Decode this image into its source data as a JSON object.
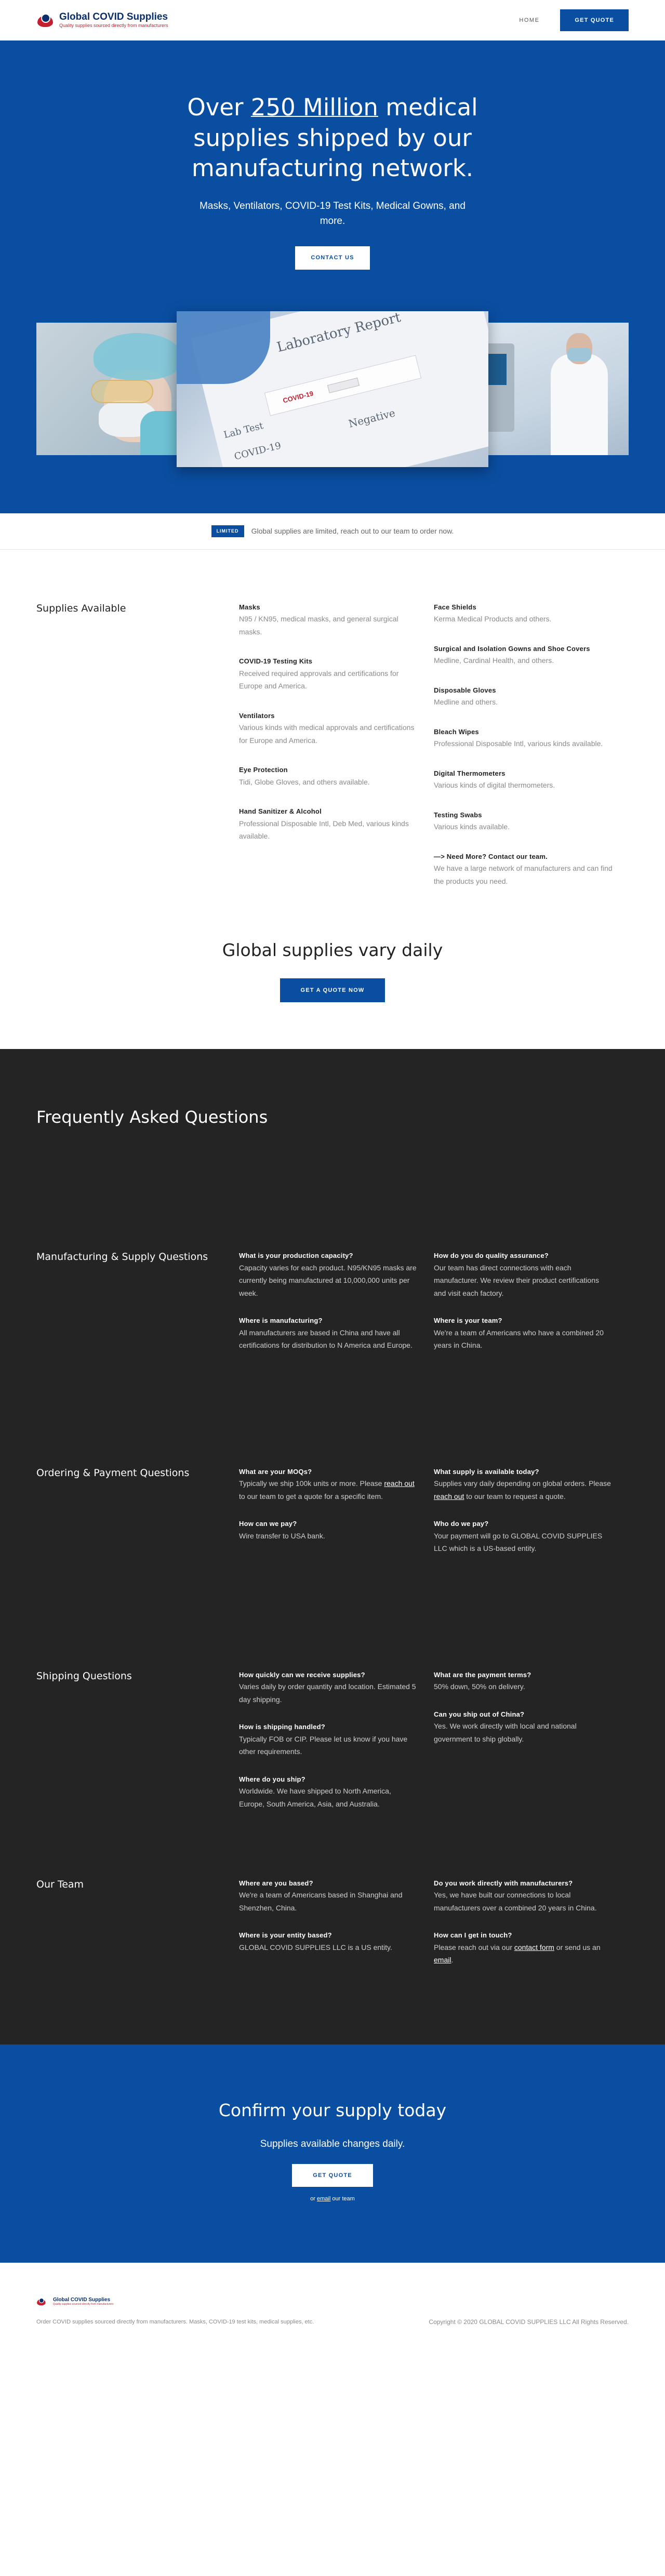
{
  "brand": {
    "name": "Global COVID Supplies",
    "tagline": "Quality supplies sourced directly from manufacturers"
  },
  "nav": {
    "home": "HOME",
    "cta": "GET QUOTE"
  },
  "hero": {
    "title_pre": "Over ",
    "title_highlight": "250 Million",
    "title_post": " medical supplies shipped by our manufacturing network.",
    "subtitle": "Masks, Ventilators, COVID-19 Test Kits, Medical Gowns, and more.",
    "cta": "CONTACT US",
    "test_card": {
      "label1": "Lab Test",
      "label2": "COVID-19",
      "label3": "Negative",
      "strip": "COVID-19",
      "heading": "Laboratory Report"
    }
  },
  "limited": {
    "badge": "LIMITED",
    "text": "Global supplies are limited, reach out to our team to order now."
  },
  "supplies": {
    "heading": "Supplies Available",
    "col_a": [
      {
        "title": "Masks",
        "desc": "N95 / KN95, medical masks, and general surgical masks."
      },
      {
        "title": "COVID-19 Testing Kits",
        "desc": "Received required approvals and certifications for Europe and America."
      },
      {
        "title": "Ventilators",
        "desc": "Various kinds with medical approvals and certifications for Europe and America."
      },
      {
        "title": "Eye Protection",
        "desc": "Tidi, Globe Gloves, and others available."
      },
      {
        "title": "Hand Sanitizer & Alcohol",
        "desc": "Professional Disposable Intl, Deb Med, various kinds available."
      }
    ],
    "col_b": [
      {
        "title": "Face Shields",
        "desc": "Kerma Medical Products and others."
      },
      {
        "title": "Surgical and Isolation Gowns and Shoe Covers",
        "desc": "Medline, Cardinal Health, and others."
      },
      {
        "title": "Disposable Gloves",
        "desc": "Medline and others."
      },
      {
        "title": "Bleach Wipes",
        "desc": "Professional Disposable Intl, various kinds available."
      },
      {
        "title": "Digital Thermometers",
        "desc": "Various kinds of digital thermometers."
      },
      {
        "title": "Testing Swabs",
        "desc": "Various kinds available."
      },
      {
        "title": "—> Need More? Contact our team.",
        "desc": "We have a large network of manufacturers and can find the products you need."
      }
    ],
    "vary_title": "Global supplies vary daily",
    "vary_cta": "GET A QUOTE NOW"
  },
  "faq": {
    "heading": "Frequently Asked Questions",
    "manufacturing": {
      "title": "Manufacturing & Supply Questions",
      "q1": {
        "q": "What is your production capacity?",
        "a": "Capacity varies for each product. N95/KN95 masks are currently being manufactured at 10,000,000 units per week."
      },
      "q2": {
        "q": "Where is manufacturing?",
        "a": "All manufacturers are based in China and have all certifications for distribution to N America and Europe."
      },
      "q3": {
        "q": "How do you do quality assurance?",
        "a": "Our team has direct connections with each manufacturer. We review their product certifications and visit each factory."
      },
      "q4": {
        "q": "Where is your team?",
        "a": "We're a team of Americans who have a combined 20 years in China."
      }
    },
    "ordering": {
      "title": "Ordering & Payment Questions",
      "q1": {
        "q": "What are your MOQs?",
        "a_pre": "Typically we ship 100k units or more. Please ",
        "a_link": "reach out",
        "a_post": " to our team to get a quote for a specific item."
      },
      "q2": {
        "q": "How can we pay?",
        "a": "Wire transfer to USA bank."
      },
      "q3": {
        "q": "What supply is available today?",
        "a_pre": "Supplies vary daily depending on global orders. Please ",
        "a_link": "reach out",
        "a_post": " to our team to request a quote."
      },
      "q4": {
        "q": "Who do we pay?",
        "a": "Your payment will go to GLOBAL COVID SUPPLIES LLC which is a US-based entity."
      }
    },
    "shipping": {
      "title": "Shipping Questions",
      "q1": {
        "q": "How quickly can we receive supplies?",
        "a": "Varies daily by order quantity and location. Estimated 5 day shipping."
      },
      "q2": {
        "q": "How is shipping handled?",
        "a": "Typically FOB or CIP. Please let us know if you have other requirements."
      },
      "q3": {
        "q": "Where do you ship?",
        "a": "Worldwide. We have shipped to North America, Europe, South America, Asia, and Australia."
      },
      "q4": {
        "q": "What are the payment terms?",
        "a": "50% down, 50% on delivery."
      },
      "q5": {
        "q": "Can you ship out of China?",
        "a": "Yes. We work directly with local and national government to ship globally."
      }
    },
    "team": {
      "title": "Our Team",
      "q1": {
        "q": "Where are you based?",
        "a": "We're a team of Americans based in Shanghai and Shenzhen, China."
      },
      "q2": {
        "q": "Where is your entity based?",
        "a": "GLOBAL COVID SUPPLIES LLC is a US entity."
      },
      "q3": {
        "q": "Do you work directly with manufacturers?",
        "a": "Yes, we have built our connections to local manufacturers over a combined 20 years in China."
      },
      "q4": {
        "q": "How can I get in touch?",
        "a_pre": "Please reach out via our ",
        "a_link1": "contact form",
        "a_mid": " or send us an ",
        "a_link2": "email",
        "a_post": "."
      }
    }
  },
  "confirm": {
    "title": "Confirm your supply today",
    "subtitle": "Supplies available changes daily.",
    "cta": "GET QUOTE",
    "tiny_pre": "or ",
    "tiny_link": "email",
    "tiny_post": " our team"
  },
  "footer": {
    "desc": "Order COVID supplies sourced directly from manufacturers. Masks, COVID-19 test kits, medical supplies, etc.",
    "copyright": "Copyright © 2020 GLOBAL COVID SUPPLIES LLC All Rights Reserved."
  },
  "colors": {
    "brand_blue": "#0a4ea1",
    "dark": "#242424",
    "logo_red": "#c41f2e",
    "logo_navy": "#0a2f6b"
  }
}
